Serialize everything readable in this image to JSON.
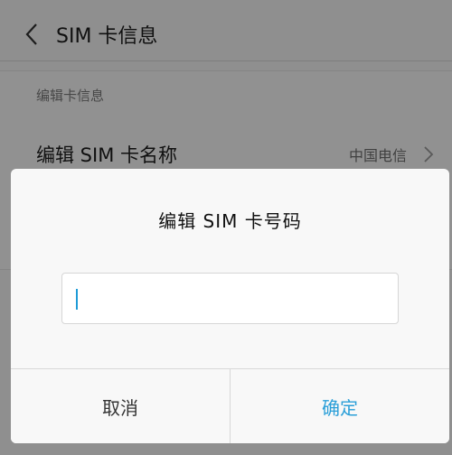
{
  "header": {
    "title": "SIM 卡信息"
  },
  "section": {
    "header": "编辑卡信息",
    "row": {
      "label": "编辑 SIM 卡名称",
      "value": "中国电信"
    }
  },
  "dialog": {
    "title": "编辑 SIM 卡号码",
    "input_value": "",
    "cancel_label": "取消",
    "confirm_label": "确定"
  },
  "icons": {
    "back": "chevron-left-icon",
    "row_arrow": "chevron-right-icon"
  },
  "colors": {
    "accent": "#2b9fd8",
    "caret": "#1e9bd7"
  }
}
